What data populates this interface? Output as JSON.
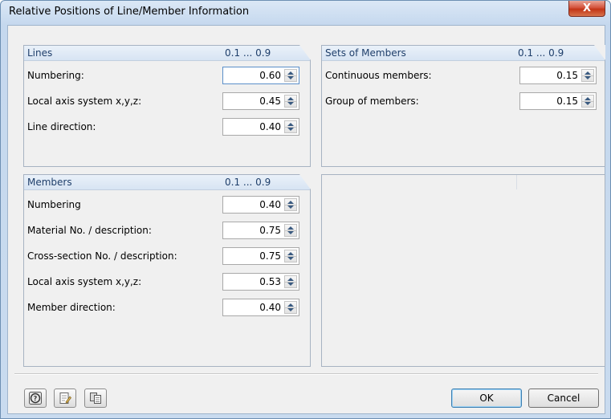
{
  "window": {
    "title": "Relative Positions of Line/Member Information",
    "close_label": "X"
  },
  "lines": {
    "title": "Lines",
    "range": "0.1 ... 0.9",
    "rows": [
      {
        "label": "Numbering:",
        "value": "0.60"
      },
      {
        "label": "Local axis system x,y,z:",
        "value": "0.45"
      },
      {
        "label": "Line direction:",
        "value": "0.40"
      }
    ]
  },
  "sets": {
    "title": "Sets of Members",
    "range": "0.1 ... 0.9",
    "rows": [
      {
        "label": "Continuous members:",
        "value": "0.15"
      },
      {
        "label": "Group of members:",
        "value": "0.15"
      }
    ]
  },
  "members": {
    "title": "Members",
    "range": "0.1 ... 0.9",
    "rows": [
      {
        "label": "Numbering",
        "value": "0.40"
      },
      {
        "label": "Material No. / description:",
        "value": "0.75"
      },
      {
        "label": "Cross-section No. / description:",
        "value": "0.75"
      },
      {
        "label": "Local axis system x,y,z:",
        "value": "0.53"
      },
      {
        "label": "Member direction:",
        "value": "0.40"
      }
    ]
  },
  "footer": {
    "ok_label": "OK",
    "cancel_label": "Cancel"
  },
  "icons": [
    "help-icon",
    "edit-icon",
    "copy-icon"
  ]
}
